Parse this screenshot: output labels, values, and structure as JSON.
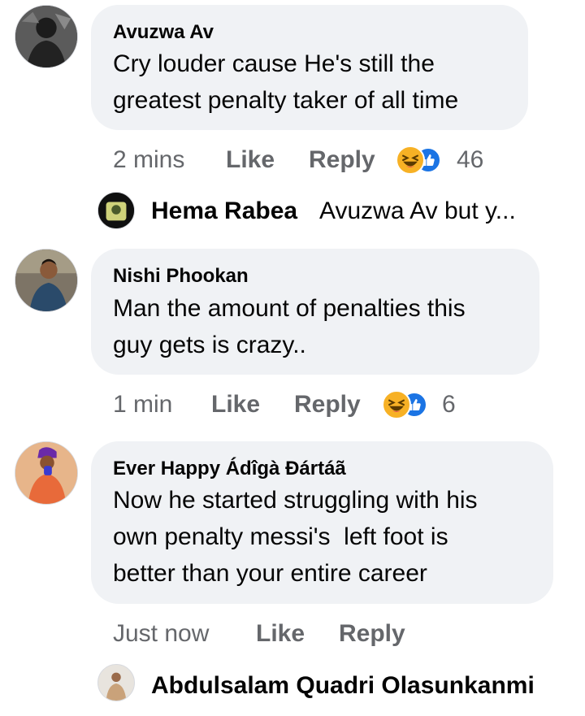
{
  "comments": [
    {
      "author": "Avuzwa Av",
      "text": "Cry louder cause He's still the greatest penalty taker of all time",
      "line1": "Cry louder cause He's still the",
      "line2": "greatest penalty taker of all time",
      "time": "2 mins",
      "like_label": "Like",
      "reply_label": "Reply",
      "reaction_count": "46",
      "reactions": [
        "haha-icon",
        "like-icon"
      ]
    },
    {
      "author": "Nishi Phookan",
      "line1": "Man the amount of penalties this",
      "line2": "guy gets is crazy..",
      "time": "1 min",
      "like_label": "Like",
      "reply_label": "Reply",
      "reaction_count": "6",
      "reactions": [
        "haha-icon",
        "like-icon"
      ]
    },
    {
      "author": "Ever Happy Ádîgà Đártáã",
      "line1": "Now he started struggling with his",
      "line2": "own penalty messi's  left foot is",
      "line3": "better than your entire career",
      "time": "Just now",
      "like_label": "Like",
      "reply_label": "Reply"
    }
  ],
  "replies": [
    {
      "author": "Hema Rabea",
      "preview": "Avuzwa Av but y..."
    },
    {
      "author": "Abdulsalam Quadri Olasunkanmi"
    }
  ],
  "colors": {
    "bubble": "#f0f2f5",
    "meta_text": "#65676b",
    "text": "#050505",
    "like_blue": "#1b74e4",
    "haha_yellow": "#f7b125"
  }
}
